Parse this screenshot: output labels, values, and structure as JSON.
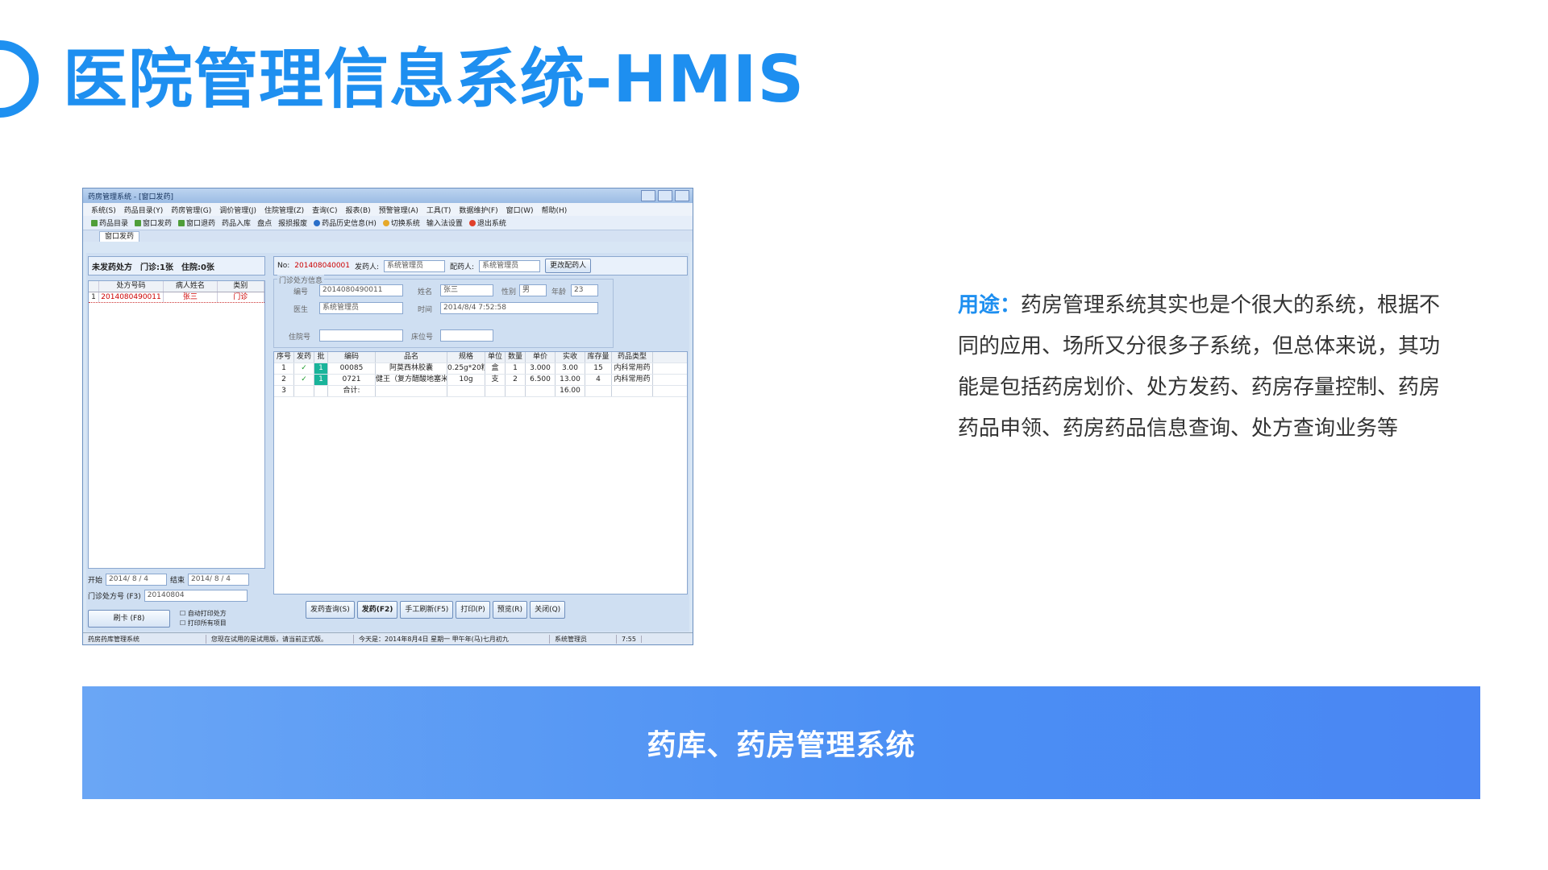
{
  "slide": {
    "title": "医院管理信息系统-HMIS",
    "desc_keyword": "用途：",
    "desc_text": "药房管理系统其实也是个很大的系统，根据不同的应用、场所又分很多子系统，但总体来说，其功能是包括药房划价、处方发药、药房存量控制、药房药品申领、药房药品信息查询、处方查询业务等",
    "banner": "药库、药房管理系统",
    "colors": {
      "accent": "#1e8ff0",
      "banner_start": "#6aa6f5",
      "banner_end": "#4a86f3"
    }
  },
  "app": {
    "title": "药房管理系统 - [窗口发药]",
    "menu": [
      "系统(S)",
      "药品目录(Y)",
      "药房管理(G)",
      "调价管理(J)",
      "住院管理(Z)",
      "查询(C)",
      "报表(B)",
      "预警管理(A)",
      "工具(T)",
      "数据维护(F)",
      "窗口(W)",
      "帮助(H)"
    ],
    "toolbar": [
      "药品目录",
      "窗口发药",
      "窗口退药",
      "药品入库",
      "盘点",
      "报损报废",
      "药品历史信息(H)",
      "切换系统",
      "输入法设置",
      "退出系统"
    ],
    "tab": "窗口发药",
    "left": {
      "header": "未发药处方",
      "mz": "门诊:1张",
      "zy": "住院:0张",
      "columns": [
        "处方号码",
        "病人姓名",
        "类别"
      ],
      "rows": [
        {
          "no": "1",
          "rx": "2014080490011",
          "name": "张三",
          "type": "门诊"
        }
      ],
      "start_label": "开始",
      "start_date": "2014/ 8 / 4",
      "end_label": "结束",
      "end_date": "2014/ 8 / 4",
      "rx_label": "门诊处方号 (F3)",
      "rx_value": "20140804",
      "card_btn": "刷卡 (F8)",
      "auto_print": "自动打印处方",
      "print_all": "打印所有项目"
    },
    "right": {
      "no_label": "No:",
      "no_value": "201408040001",
      "sender_label": "发药人:",
      "sender_value": "系统管理员",
      "matcher_label": "配药人:",
      "matcher_value": "系统管理员",
      "change_btn": "更改配药人",
      "group_label": "门诊处方信息",
      "id_label": "编号",
      "id_value": "2014080490011",
      "name_label": "姓名",
      "name_value": "张三",
      "sex_label": "性别",
      "sex_value": "男",
      "age_label": "年龄",
      "age_value": "23",
      "doctor_label": "医生",
      "doctor_value": "系统管理员",
      "time_label": "时间",
      "time_value": "2014/8/4 7:52:58",
      "hosp_label": "住院号",
      "bed_label": "床位号",
      "columns": [
        "序号",
        "发药",
        "批",
        "编码",
        "品名",
        "规格",
        "单位",
        "数量",
        "单价",
        "实收",
        "库存量",
        "药品类型"
      ],
      "rows": [
        {
          "no": "1",
          "issue": "✓",
          "batch": "1",
          "code": "00085",
          "name": "阿莫西林胶囊",
          "spec": "0.25g*20粒",
          "unit": "盒",
          "qty": "1",
          "price": "3.000",
          "paid": "3.00",
          "stock": "15",
          "type": "内科常用药"
        },
        {
          "no": "2",
          "issue": "✓",
          "batch": "1",
          "code": "0721",
          "name": "健王（复方醋酸地塞米松乳膏）",
          "spec": "10g",
          "unit": "支",
          "qty": "2",
          "price": "6.500",
          "paid": "13.00",
          "stock": "4",
          "type": "内科常用药"
        },
        {
          "no": "3",
          "issue": "",
          "batch": "",
          "code": "合计:",
          "name": "",
          "spec": "",
          "unit": "",
          "qty": "",
          "price": "",
          "paid": "16.00",
          "stock": "",
          "type": ""
        }
      ],
      "buttons": [
        "发药查询(S)",
        "发药(F2)",
        "手工刷新(F5)",
        "打印(P)",
        "预览(R)",
        "关闭(Q)"
      ]
    },
    "status": [
      "药房药库管理系统",
      "您现在试用的是试用版，请当前正式版。",
      "今天是：2014年8月4日 星期一 甲午年(马)七月初九",
      "系统管理员",
      "7:55"
    ]
  }
}
